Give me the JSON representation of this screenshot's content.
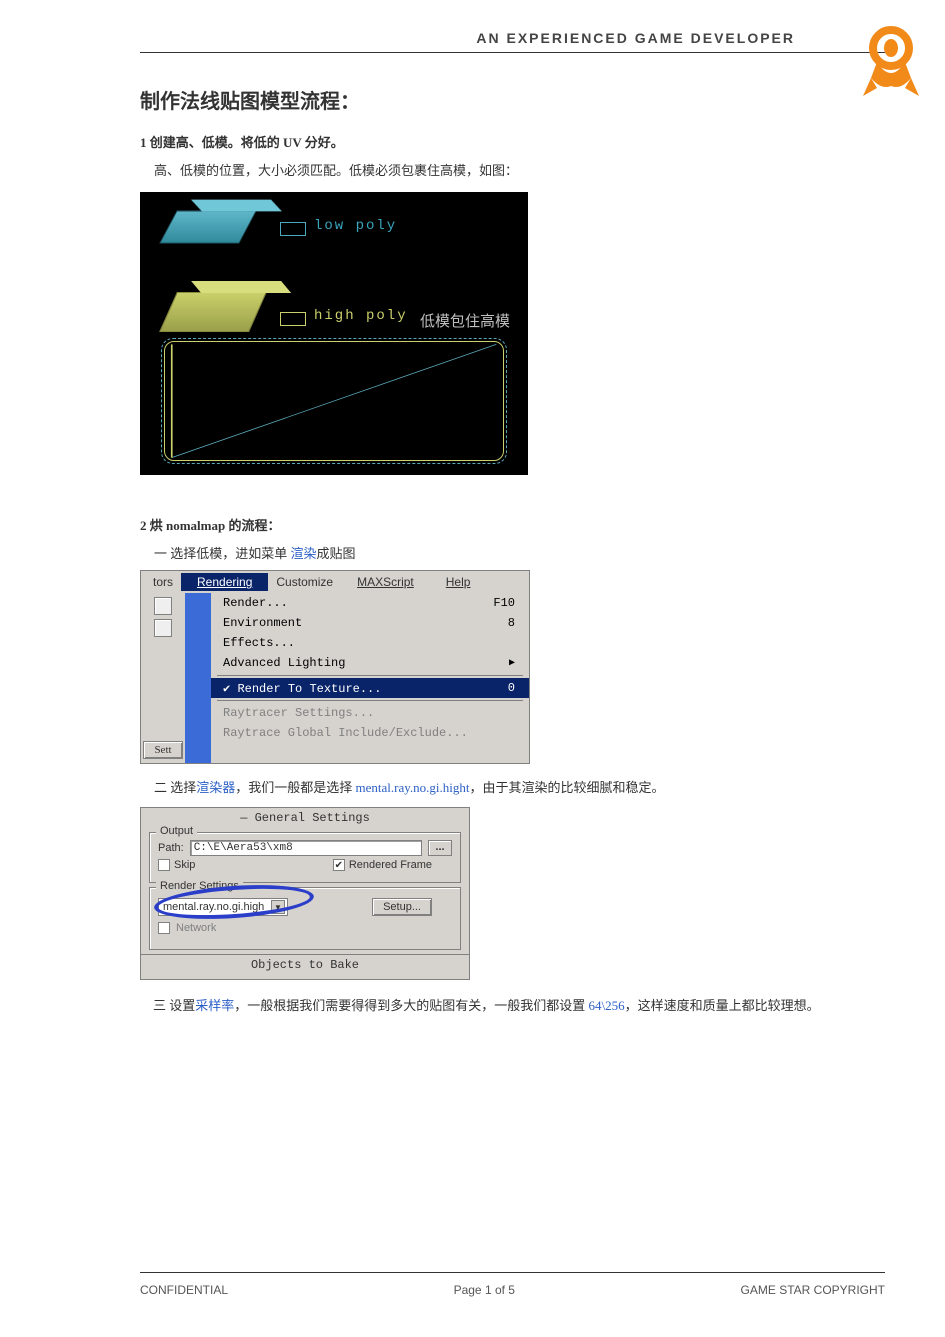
{
  "header": {
    "title": "AN EXPERIENCED GAME DEVELOPER"
  },
  "title": "制作法线贴图模型流程：",
  "s1": {
    "heading": "1 创建高、低模。将低的 UV 分好。",
    "body": "高、低模的位置，大小必须匹配。低模必须包裹住高模，如图：",
    "low_label": "low poly",
    "high_label": "high poly",
    "annotation": "低模包住高模"
  },
  "s2": {
    "heading": "2 烘 nomalmap 的流程：",
    "step1_prefix": "一 选择低模，进如菜单 ",
    "step1_link": "渲染",
    "step1_suffix": "成贴图",
    "menubar": {
      "left": "tors",
      "items": [
        "Rendering",
        "Customize",
        "MAXScript",
        "Help"
      ],
      "selected": 0
    },
    "menu_items": [
      {
        "label": "Render...",
        "shortcut": "F10"
      },
      {
        "label": "Environment",
        "shortcut": "8"
      },
      {
        "label": "Effects..."
      },
      {
        "label": "Advanced Lighting",
        "submenu": true
      },
      {
        "sep": true
      },
      {
        "label": "Render To Texture...",
        "shortcut": "0",
        "selected": true,
        "check": true
      },
      {
        "sep": true
      },
      {
        "label": "Raytracer Settings...",
        "disabled": true
      },
      {
        "label": "Raytrace Global Include/Exclude...",
        "disabled": true
      }
    ],
    "side_button": "Sett",
    "step2_prefix": "二 选择",
    "step2_link1": "渲染器",
    "step2_mid": "，我们一般都是选择 ",
    "step2_link2": "mental.ray.no.gi.hight",
    "step2_suffix": "，由于其渲染的比较细腻和稳定。",
    "panel": {
      "title": "General Settings",
      "output_legend": "Output",
      "path_label": "Path:",
      "path_value": "C:\\E\\Aera53\\xm8",
      "browse": "...",
      "skip_label": "Skip",
      "rendered_label": "Rendered Frame",
      "render_legend": "Render Settings",
      "combo_value": "mental.ray.no.gi.high",
      "setup_btn": "Setup...",
      "network_label": "Network",
      "objects_title": "Objects to Bake"
    },
    "step3_prefix": "三 设置",
    "step3_link": "采样率",
    "step3_mid": "，一般根据我们需要得得到多大的贴图有关，一般我们都设置 ",
    "step3_val": "64\\256",
    "step3_suffix": "，这样速度和质量上都比较理想。"
  },
  "footer": {
    "left": "CONFIDENTIAL",
    "center": "Page 1 of 5",
    "right": "GAME STAR COPYRIGHT"
  }
}
